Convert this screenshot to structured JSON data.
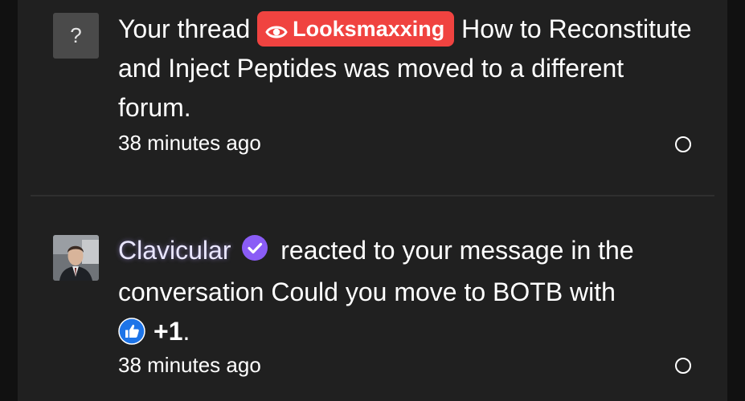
{
  "colors": {
    "background": "#111111",
    "panel": "#202020",
    "divider": "#2f2f2f",
    "prefix_badge": "#f04340",
    "verified_badge": "#8a5cf6",
    "like_reaction": "#1d74e8"
  },
  "notifications": [
    {
      "avatar_placeholder": "?",
      "text_before": "Your thread",
      "thread_prefix": "Looksmaxxing",
      "prefix_icon": "eye-icon",
      "thread_title": "How to Reconstitute and Inject Peptides",
      "text_after": "was moved to a different forum.",
      "time": "38 minutes ago",
      "read_toggle_icon": "circle-icon"
    },
    {
      "avatar": "user-avatar",
      "username": "Clavicular",
      "verified_icon": "verified-check-icon",
      "action_text": "reacted to your message in the conversation Could you move to BOTB with",
      "reaction_icon": "thumbs-up-icon",
      "reaction_text": "+1",
      "end_punct": ".",
      "time": "38 minutes ago",
      "read_toggle_icon": "circle-icon"
    }
  ]
}
